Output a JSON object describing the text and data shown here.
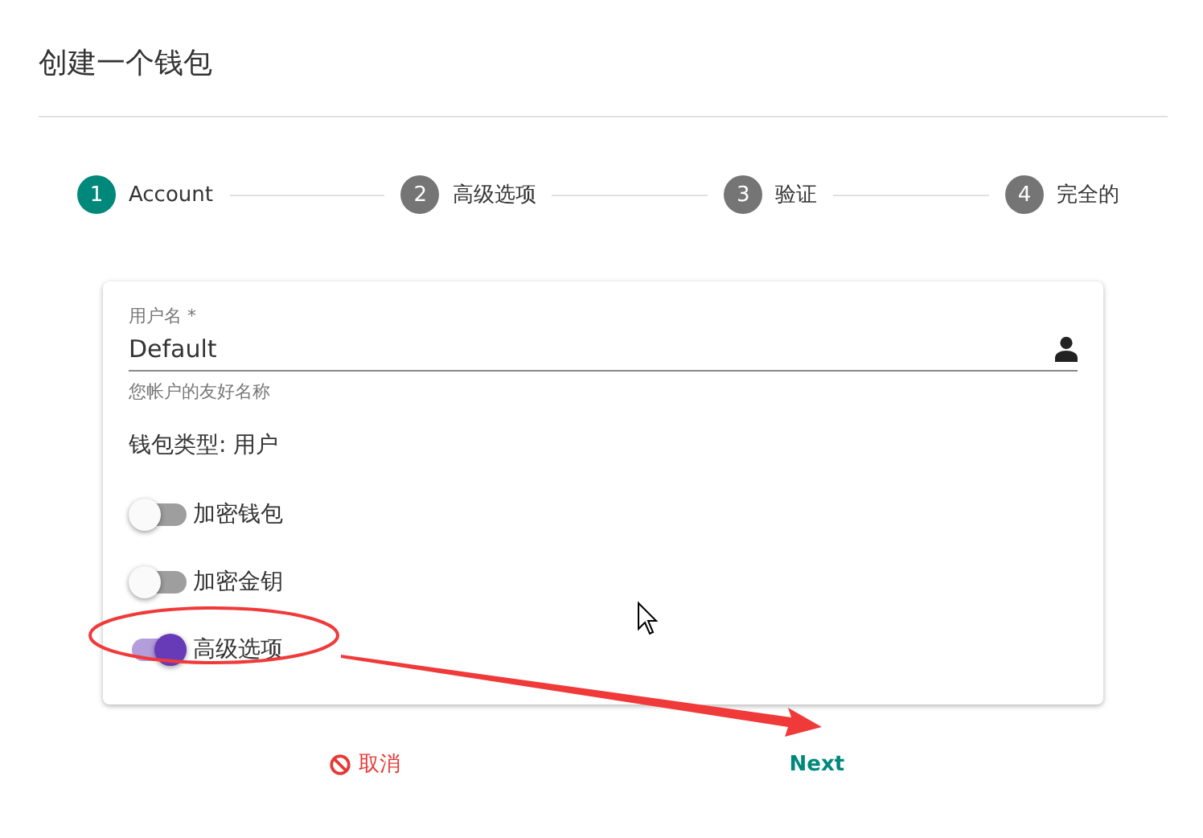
{
  "dialog": {
    "title": "创建一个钱包"
  },
  "steps": [
    {
      "number": "1",
      "label": "Account",
      "selected": true
    },
    {
      "number": "2",
      "label": "高级选项",
      "selected": false
    },
    {
      "number": "3",
      "label": "验证",
      "selected": false
    },
    {
      "number": "4",
      "label": "完全的",
      "selected": false
    }
  ],
  "username_field": {
    "label": "用户名 *",
    "value": "Default",
    "hint": "您帐户的友好名称"
  },
  "wallet_type": "钱包类型: 用户",
  "switches": [
    {
      "label": "加密钱包",
      "on": false
    },
    {
      "label": "加密金钥",
      "on": false
    },
    {
      "label": "高级选项",
      "on": true
    }
  ],
  "buttons": [
    {
      "label": "取消",
      "kind": "cancel"
    },
    {
      "label": "Next",
      "kind": "next"
    }
  ]
}
